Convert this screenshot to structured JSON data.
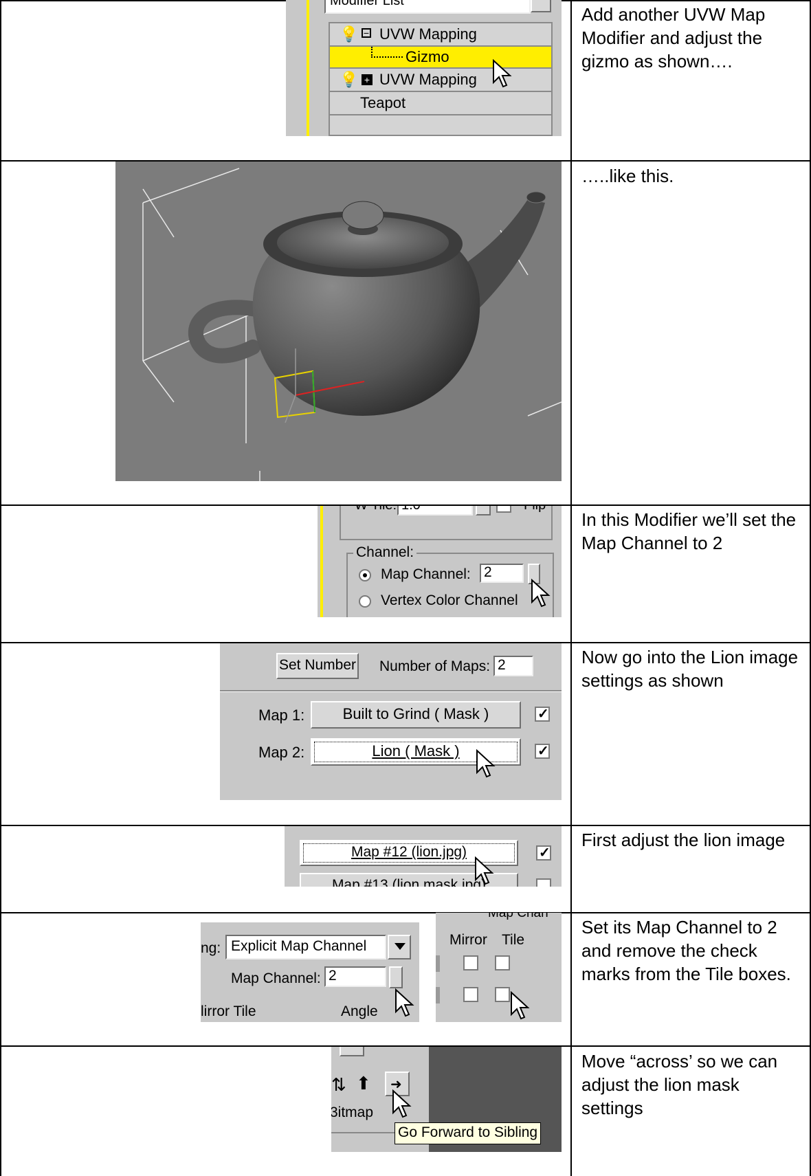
{
  "rows": [
    {
      "caption": "Add another UVW Map Modifier and adjust the gizmo as shown…."
    },
    {
      "caption": "…..like this."
    },
    {
      "caption": "In this Modifier we’ll set the Map Channel to 2"
    },
    {
      "caption": "Now go into the Lion image settings as shown"
    },
    {
      "caption": "First adjust the lion image"
    },
    {
      "caption": "Set its Map Channel to 2 and remove the check marks from the Tile boxes."
    },
    {
      "caption": "Move “across’ so we can adjust the lion mask settings"
    }
  ],
  "shot1": {
    "modifier_list": "Modifier List",
    "uvw1": "UVW Mapping",
    "gizmo": "Gizmo",
    "uvw2": "UVW Mapping",
    "teapot": "Teapot"
  },
  "shot3": {
    "wtile_label": "W Tile:",
    "wtile_value": "1.0",
    "flip": "Flip",
    "group": "Channel:",
    "map_channel_label": "Map Channel:",
    "map_channel_value": "2",
    "vertex_color": "Vertex Color Channel"
  },
  "shot4": {
    "set_number": "Set Number",
    "num_maps_label": "Number of Maps:",
    "num_maps_value": "2",
    "map1_label": "Map 1:",
    "map1_btn": "Built to Grind  ( Mask )",
    "map2_label": "Map 2:",
    "map2_btn": "Lion  ( Mask )"
  },
  "shot5": {
    "map12": "Map #12 (lion.jpg)",
    "map13": "Map #13 (lion mask.jpg)"
  },
  "shot6": {
    "mapping_label": "ng:",
    "mapping_value": "Explicit Map Channel",
    "map_channel_label": "Map Channel:",
    "map_channel_value": "2",
    "mirror_tile_bottom": "lirror Tile",
    "angle": "Angle",
    "map_chan_top": "Map Chan",
    "mirror": "Mirror",
    "tile": "Tile"
  },
  "shot7": {
    "bitmap": "3itmap",
    "tooltip": "Go Forward to Sibling"
  },
  "colors": {
    "highlight_yellow": "#ffee00",
    "panel_grey": "#c8c8c8",
    "viewport_grey": "#808080"
  }
}
